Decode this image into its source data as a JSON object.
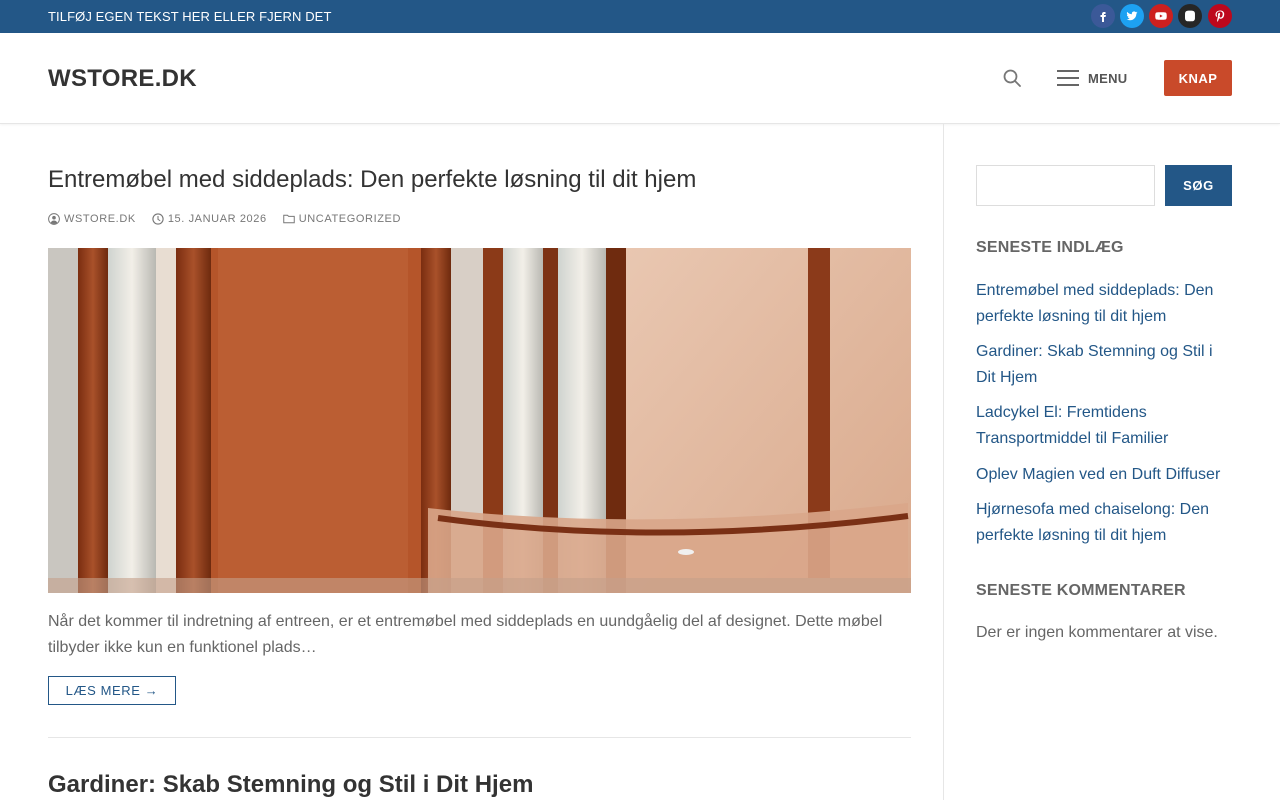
{
  "topbar": {
    "text": "TILFØJ EGEN TEKST HER ELLER FJERN DET",
    "social": [
      {
        "name": "facebook-icon",
        "color": "#3b5998"
      },
      {
        "name": "twitter-icon",
        "color": "#1da1f2"
      },
      {
        "name": "youtube-icon",
        "color": "#cd201f"
      },
      {
        "name": "instagram-icon",
        "color": "#262626"
      },
      {
        "name": "pinterest-icon",
        "color": "#bd081c"
      }
    ]
  },
  "header": {
    "logo": "WSTORE.DK",
    "menu_label": "MENU",
    "button_label": "KNAP"
  },
  "posts": [
    {
      "title": "Entremøbel med siddeplads: Den perfekte løsning til dit hjem",
      "author": "WSTORE.DK",
      "date": "15. JANUAR 2026",
      "category": "UNCATEGORIZED",
      "excerpt": "Når det kommer til indretning af entreen, er et entremøbel med siddeplads en uundgåelig del af designet. Dette møbel tilbyder ikke kun en funktionel plads…",
      "read_more": "LÆS MERE →"
    },
    {
      "title": "Gardiner: Skab Stemning og Stil i Dit Hjem"
    }
  ],
  "sidebar": {
    "search_button": "SØG",
    "search_value": "",
    "recent_title": "SENESTE INDLÆG",
    "recent_posts": [
      "Entremøbel med siddeplads: Den perfekte løsning til dit hjem",
      "Gardiner: Skab Stemning og Stil i Dit Hjem",
      "Ladcykel El: Fremtidens Transportmiddel til Familier",
      "Oplev Magien ved en Duft Diffuser",
      "Hjørnesofa med chaiselong: Den perfekte løsning til dit hjem"
    ],
    "comments_title": "SENESTE KOMMENTARER",
    "comments_empty": "Der er ingen kommentarer at vise."
  },
  "colors": {
    "topbar": "#235787",
    "accent": "#235787",
    "button": "#c94a2a"
  }
}
